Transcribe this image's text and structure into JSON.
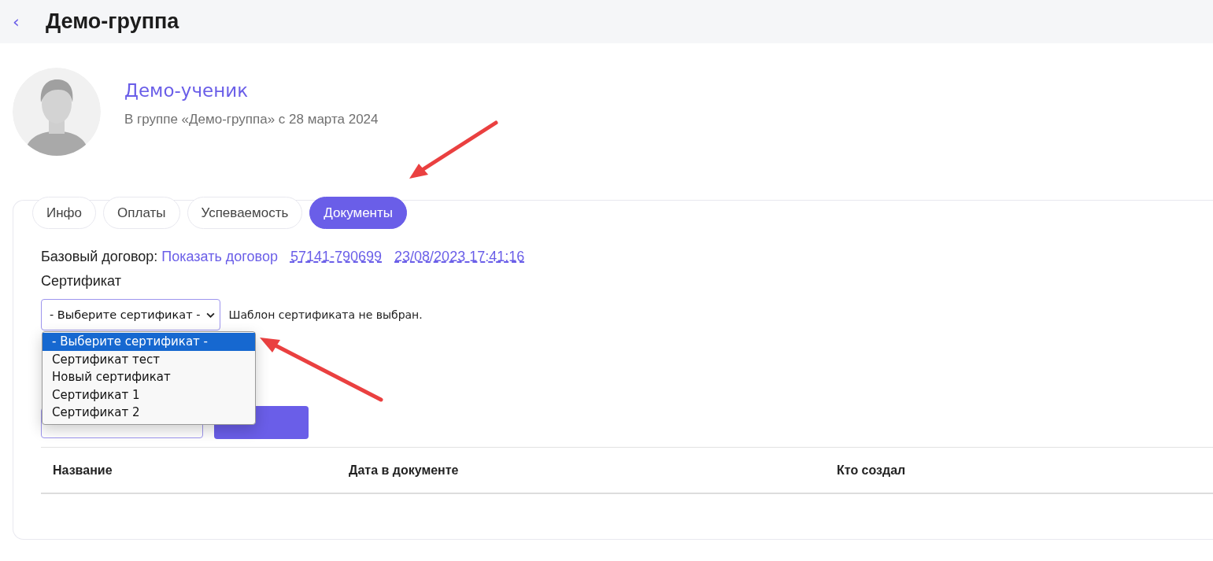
{
  "header": {
    "back": "‹",
    "title": "Демо-группа"
  },
  "student": {
    "name": "Демо-ученик",
    "subtitle": "В группе «Демо-группа» с 28 марта 2024"
  },
  "tabs": [
    {
      "label": "Инфо",
      "selected": false
    },
    {
      "label": "Оплаты",
      "selected": false
    },
    {
      "label": "Успеваемость",
      "selected": false
    },
    {
      "label": "Документы",
      "selected": true
    }
  ],
  "contract": {
    "label": "Базовый договор:",
    "show_link": "Показать договор",
    "number": "57141-790699",
    "date": "23/08/2023 17:41:16"
  },
  "certificate": {
    "label": "Сертификат",
    "select_value": "- Выберите сертификат -",
    "note": "Шаблон сертификата не выбран.",
    "options": [
      {
        "label": "- Выберите сертификат -",
        "selected": true
      },
      {
        "label": "Сертификат тест",
        "selected": false
      },
      {
        "label": "Новый сертификат",
        "selected": false
      },
      {
        "label": "Сертификат 1",
        "selected": false
      },
      {
        "label": "Сертификат 2",
        "selected": false
      }
    ]
  },
  "document": {
    "kind": "covered"
  },
  "table": {
    "columns": [
      "Название",
      "Дата в документе",
      "Кто создал"
    ]
  }
}
